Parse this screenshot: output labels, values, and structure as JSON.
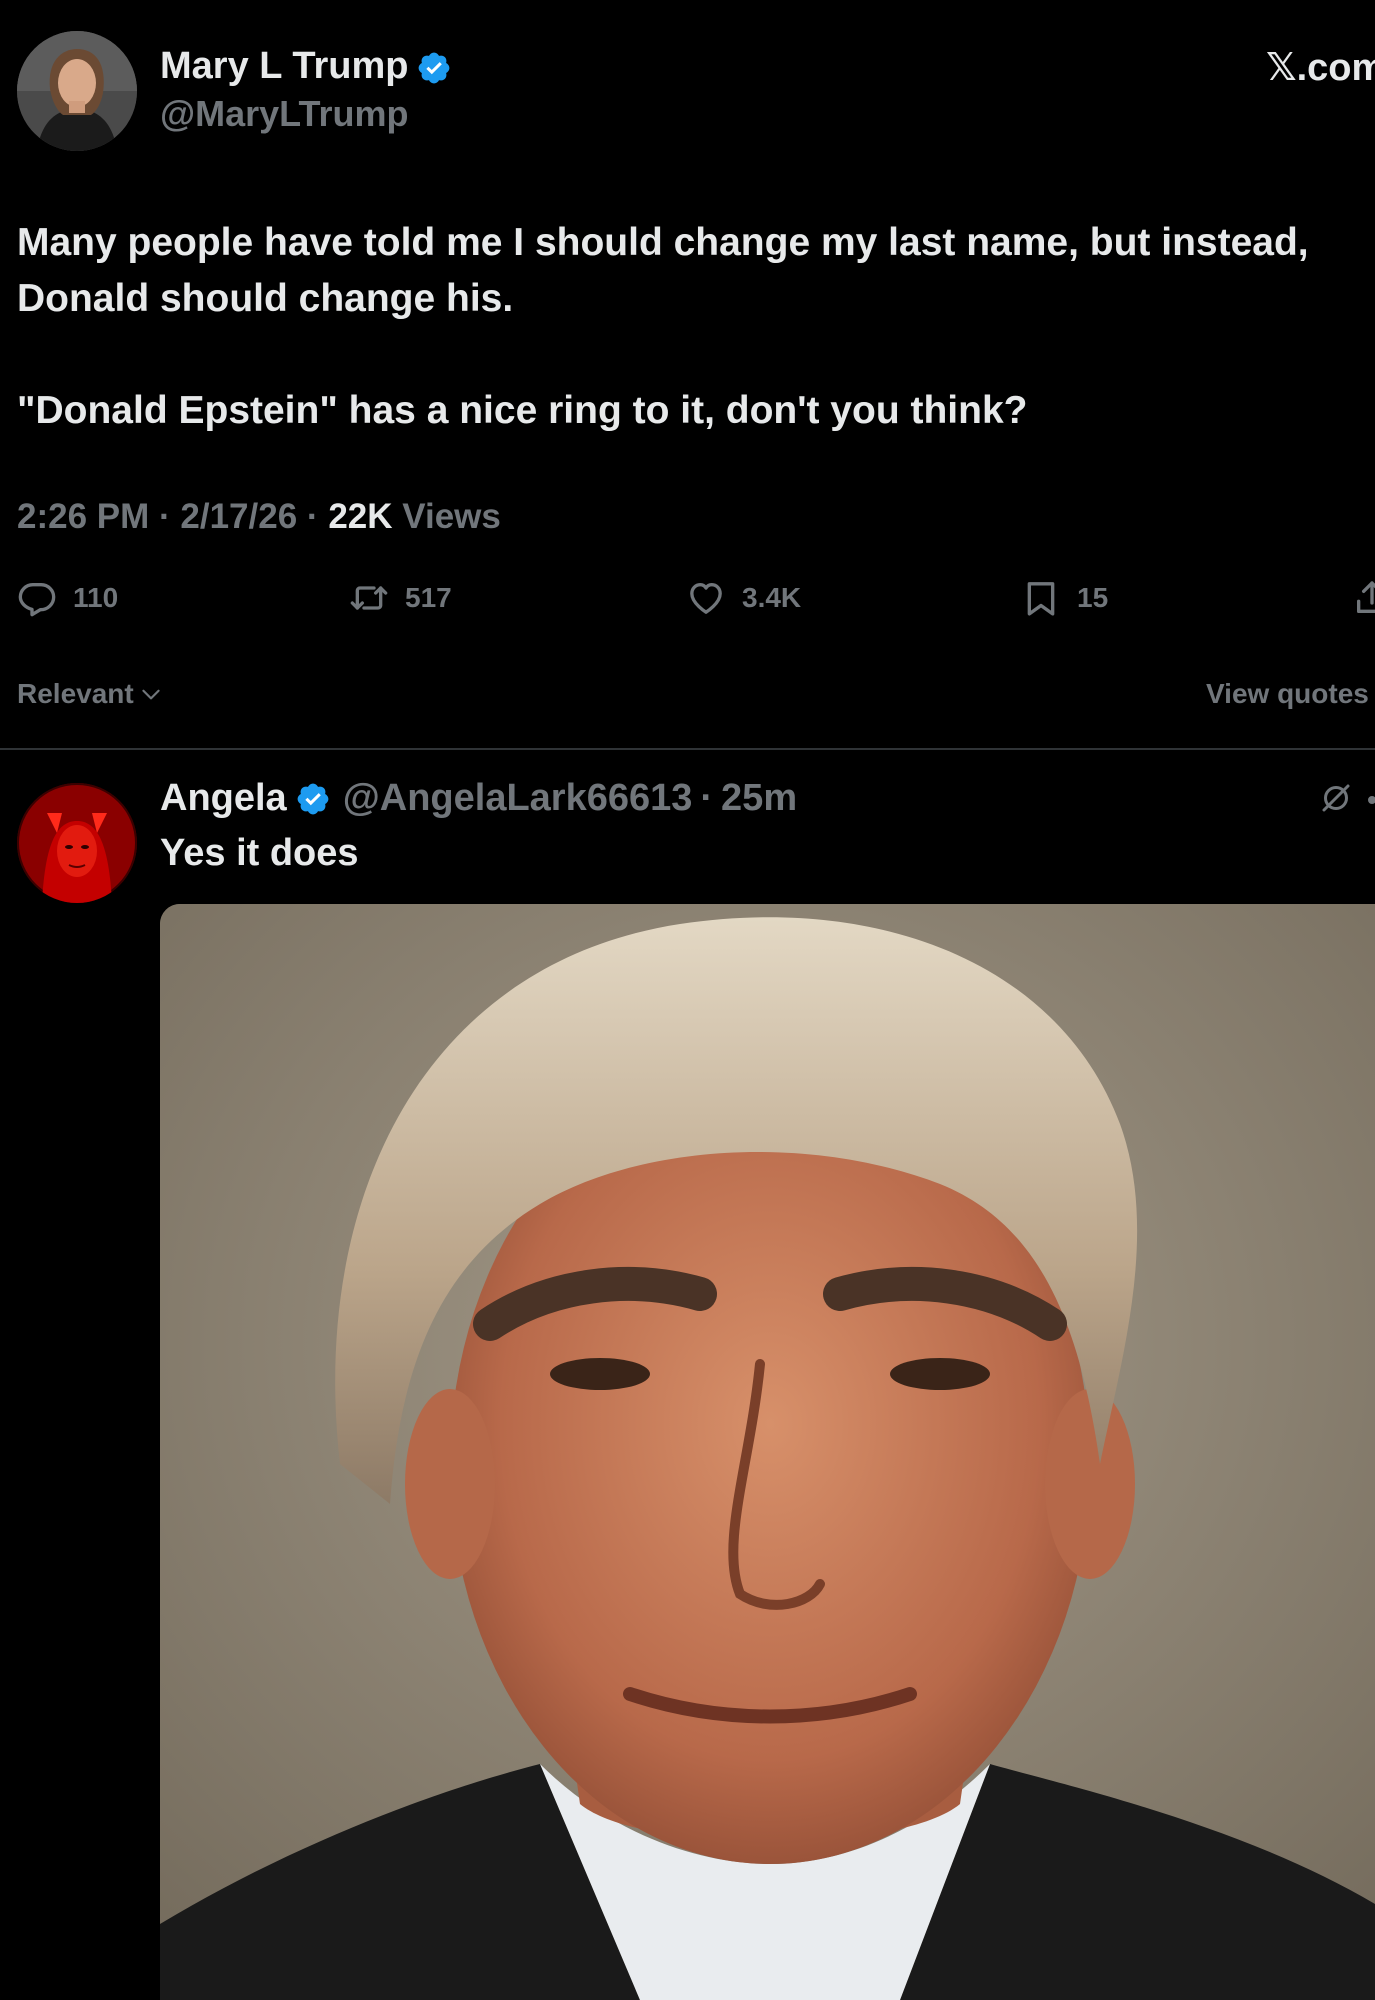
{
  "post": {
    "author_name": "Mary L Trump",
    "author_handle": "@MaryLTrump",
    "source": "𝕏.com",
    "text_line1": "Many people have told me I should change my last name, but instead,",
    "text_line2": "Donald should change his.",
    "text_line3": "\"Donald Epstein\" has a nice ring to it, don't you think?",
    "time": "2:26 PM",
    "sep": "·",
    "date": "2/17/26",
    "views_count": "22K",
    "views_label": "Views"
  },
  "actions": {
    "replies": "110",
    "reposts": "517",
    "likes": "3.4K",
    "bookmarks": "15"
  },
  "sort": {
    "label": "Relevant",
    "view_quotes": "View quotes"
  },
  "reply": {
    "name": "Angela",
    "handle": "@AngelaLark66613",
    "sep": "·",
    "time": "25m",
    "text": "Yes it does"
  },
  "colors": {
    "background": "#000000",
    "text_primary": "#e7e9ea",
    "text_secondary": "#71767b",
    "verified_blue": "#1d9bf0",
    "divider": "#2f3336"
  },
  "icons": {
    "verified": "verified-badge-icon",
    "reply": "speech-bubble-icon",
    "repost": "repost-arrows-icon",
    "like": "heart-icon",
    "bookmark": "bookmark-icon",
    "share": "share-icon",
    "chevron": "chevron-down-icon",
    "grok": "grok-icon"
  }
}
